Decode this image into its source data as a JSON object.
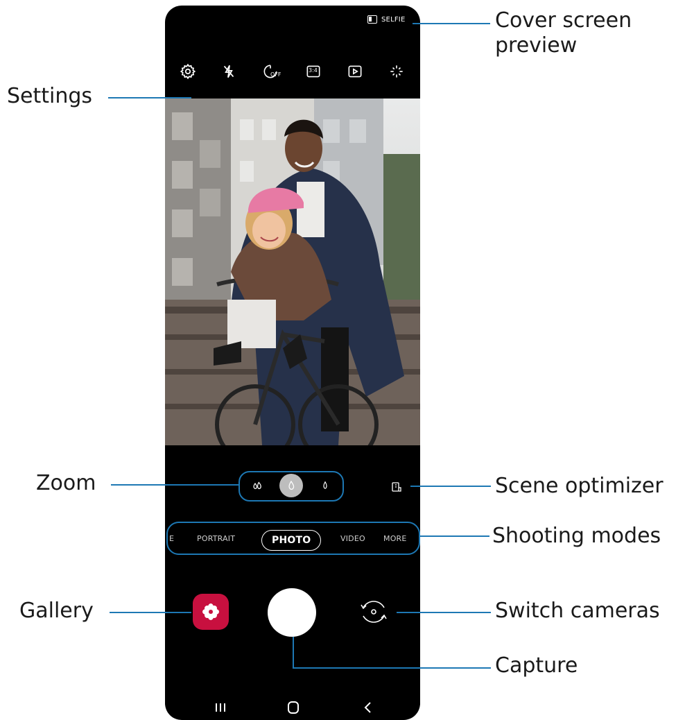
{
  "phone": {
    "cover_screen_button": {
      "label": "SELFIE",
      "icon": "cover-screen-icon"
    },
    "toolbar": [
      {
        "name": "settings",
        "icon": "gear-icon"
      },
      {
        "name": "flash",
        "icon": "flash-off-icon"
      },
      {
        "name": "timer",
        "icon": "timer-off-icon",
        "text": "OFF"
      },
      {
        "name": "ratio",
        "icon": "ratio-icon",
        "text": "3:4"
      },
      {
        "name": "motion-photo",
        "icon": "motion-photo-icon"
      },
      {
        "name": "effects",
        "icon": "sparkle-icon"
      }
    ],
    "zoom": {
      "levels": [
        "ultra-wide",
        "wide",
        "telephoto"
      ],
      "selected": "wide"
    },
    "scene_optimizer": {
      "icon": "scene-optimizer-icon"
    },
    "modes": [
      "E",
      "PORTRAIT",
      "PHOTO",
      "VIDEO",
      "MORE"
    ],
    "selected_mode": "PHOTO",
    "gallery": {
      "icon": "flower-icon",
      "color": "#c8103f"
    },
    "switch_camera": {
      "icon": "switch-camera-icon"
    },
    "nav": {
      "recent": "recent-apps-icon",
      "home": "home-icon",
      "back": "back-icon"
    }
  },
  "callouts": {
    "cover_screen": [
      "Cover screen",
      "preview"
    ],
    "settings": "Settings",
    "zoom": "Zoom",
    "scene_optimizer": "Scene optimizer",
    "shooting_modes": "Shooting modes",
    "gallery": "Gallery",
    "switch_cameras": "Switch cameras",
    "capture": "Capture"
  },
  "colors": {
    "callout_line": "#1d78b4",
    "gallery": "#c8103f"
  }
}
